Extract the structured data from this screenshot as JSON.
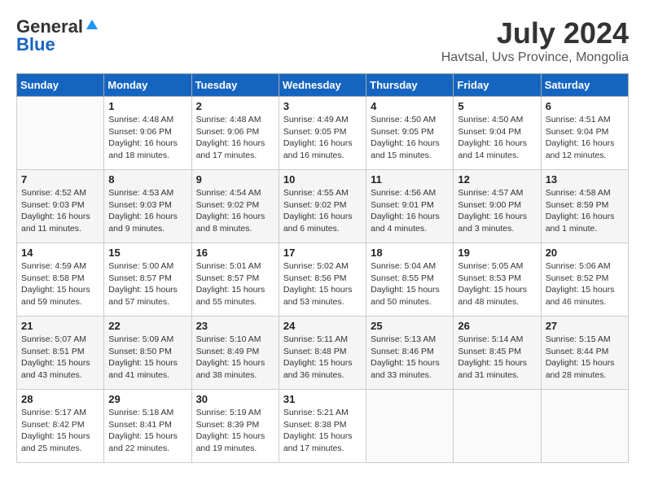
{
  "header": {
    "logo_general": "General",
    "logo_blue": "Blue",
    "month": "July 2024",
    "location": "Havtsal, Uvs Province, Mongolia"
  },
  "weekdays": [
    "Sunday",
    "Monday",
    "Tuesday",
    "Wednesday",
    "Thursday",
    "Friday",
    "Saturday"
  ],
  "weeks": [
    [
      {
        "day": "",
        "info": ""
      },
      {
        "day": "1",
        "info": "Sunrise: 4:48 AM\nSunset: 9:06 PM\nDaylight: 16 hours\nand 18 minutes."
      },
      {
        "day": "2",
        "info": "Sunrise: 4:48 AM\nSunset: 9:06 PM\nDaylight: 16 hours\nand 17 minutes."
      },
      {
        "day": "3",
        "info": "Sunrise: 4:49 AM\nSunset: 9:05 PM\nDaylight: 16 hours\nand 16 minutes."
      },
      {
        "day": "4",
        "info": "Sunrise: 4:50 AM\nSunset: 9:05 PM\nDaylight: 16 hours\nand 15 minutes."
      },
      {
        "day": "5",
        "info": "Sunrise: 4:50 AM\nSunset: 9:04 PM\nDaylight: 16 hours\nand 14 minutes."
      },
      {
        "day": "6",
        "info": "Sunrise: 4:51 AM\nSunset: 9:04 PM\nDaylight: 16 hours\nand 12 minutes."
      }
    ],
    [
      {
        "day": "7",
        "info": "Sunrise: 4:52 AM\nSunset: 9:03 PM\nDaylight: 16 hours\nand 11 minutes."
      },
      {
        "day": "8",
        "info": "Sunrise: 4:53 AM\nSunset: 9:03 PM\nDaylight: 16 hours\nand 9 minutes."
      },
      {
        "day": "9",
        "info": "Sunrise: 4:54 AM\nSunset: 9:02 PM\nDaylight: 16 hours\nand 8 minutes."
      },
      {
        "day": "10",
        "info": "Sunrise: 4:55 AM\nSunset: 9:02 PM\nDaylight: 16 hours\nand 6 minutes."
      },
      {
        "day": "11",
        "info": "Sunrise: 4:56 AM\nSunset: 9:01 PM\nDaylight: 16 hours\nand 4 minutes."
      },
      {
        "day": "12",
        "info": "Sunrise: 4:57 AM\nSunset: 9:00 PM\nDaylight: 16 hours\nand 3 minutes."
      },
      {
        "day": "13",
        "info": "Sunrise: 4:58 AM\nSunset: 8:59 PM\nDaylight: 16 hours\nand 1 minute."
      }
    ],
    [
      {
        "day": "14",
        "info": "Sunrise: 4:59 AM\nSunset: 8:58 PM\nDaylight: 15 hours\nand 59 minutes."
      },
      {
        "day": "15",
        "info": "Sunrise: 5:00 AM\nSunset: 8:57 PM\nDaylight: 15 hours\nand 57 minutes."
      },
      {
        "day": "16",
        "info": "Sunrise: 5:01 AM\nSunset: 8:57 PM\nDaylight: 15 hours\nand 55 minutes."
      },
      {
        "day": "17",
        "info": "Sunrise: 5:02 AM\nSunset: 8:56 PM\nDaylight: 15 hours\nand 53 minutes."
      },
      {
        "day": "18",
        "info": "Sunrise: 5:04 AM\nSunset: 8:55 PM\nDaylight: 15 hours\nand 50 minutes."
      },
      {
        "day": "19",
        "info": "Sunrise: 5:05 AM\nSunset: 8:53 PM\nDaylight: 15 hours\nand 48 minutes."
      },
      {
        "day": "20",
        "info": "Sunrise: 5:06 AM\nSunset: 8:52 PM\nDaylight: 15 hours\nand 46 minutes."
      }
    ],
    [
      {
        "day": "21",
        "info": "Sunrise: 5:07 AM\nSunset: 8:51 PM\nDaylight: 15 hours\nand 43 minutes."
      },
      {
        "day": "22",
        "info": "Sunrise: 5:09 AM\nSunset: 8:50 PM\nDaylight: 15 hours\nand 41 minutes."
      },
      {
        "day": "23",
        "info": "Sunrise: 5:10 AM\nSunset: 8:49 PM\nDaylight: 15 hours\nand 38 minutes."
      },
      {
        "day": "24",
        "info": "Sunrise: 5:11 AM\nSunset: 8:48 PM\nDaylight: 15 hours\nand 36 minutes."
      },
      {
        "day": "25",
        "info": "Sunrise: 5:13 AM\nSunset: 8:46 PM\nDaylight: 15 hours\nand 33 minutes."
      },
      {
        "day": "26",
        "info": "Sunrise: 5:14 AM\nSunset: 8:45 PM\nDaylight: 15 hours\nand 31 minutes."
      },
      {
        "day": "27",
        "info": "Sunrise: 5:15 AM\nSunset: 8:44 PM\nDaylight: 15 hours\nand 28 minutes."
      }
    ],
    [
      {
        "day": "28",
        "info": "Sunrise: 5:17 AM\nSunset: 8:42 PM\nDaylight: 15 hours\nand 25 minutes."
      },
      {
        "day": "29",
        "info": "Sunrise: 5:18 AM\nSunset: 8:41 PM\nDaylight: 15 hours\nand 22 minutes."
      },
      {
        "day": "30",
        "info": "Sunrise: 5:19 AM\nSunset: 8:39 PM\nDaylight: 15 hours\nand 19 minutes."
      },
      {
        "day": "31",
        "info": "Sunrise: 5:21 AM\nSunset: 8:38 PM\nDaylight: 15 hours\nand 17 minutes."
      },
      {
        "day": "",
        "info": ""
      },
      {
        "day": "",
        "info": ""
      },
      {
        "day": "",
        "info": ""
      }
    ]
  ]
}
